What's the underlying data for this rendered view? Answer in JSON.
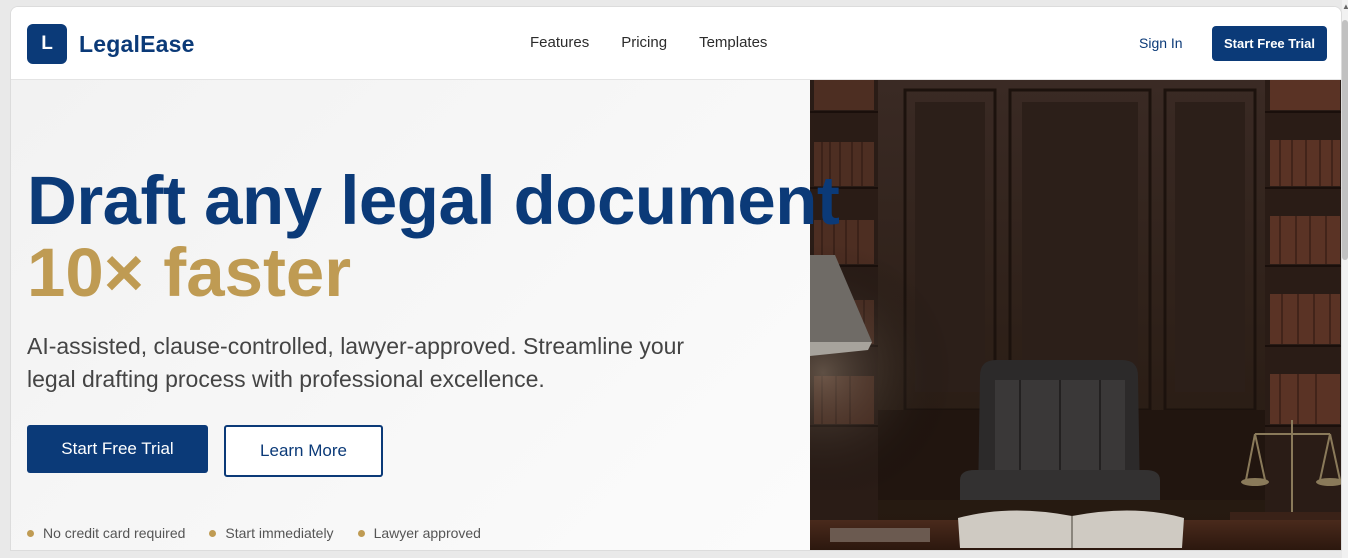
{
  "brand": {
    "mark": "L",
    "name": "LegalEase"
  },
  "nav": {
    "items": [
      {
        "label": "Features"
      },
      {
        "label": "Pricing"
      },
      {
        "label": "Templates"
      }
    ]
  },
  "header": {
    "signin_label": "Sign In",
    "cta_label": "Start Free Trial"
  },
  "hero": {
    "headline_line1": "Draft any legal document",
    "headline_line2": "10× faster",
    "subtext": "AI-assisted, clause-controlled, lawyer-approved. Streamline your legal drafting process with professional excellence.",
    "primary_cta": "Start Free Trial",
    "secondary_cta": "Learn More",
    "badges": [
      "No credit card required",
      "Start immediately",
      "Lawyer approved"
    ]
  },
  "colors": {
    "brand_navy": "#0b3a78",
    "accent_gold": "#bf9b53",
    "text_gray": "#444444"
  },
  "image": {
    "description_icon": "law-office-photo"
  }
}
